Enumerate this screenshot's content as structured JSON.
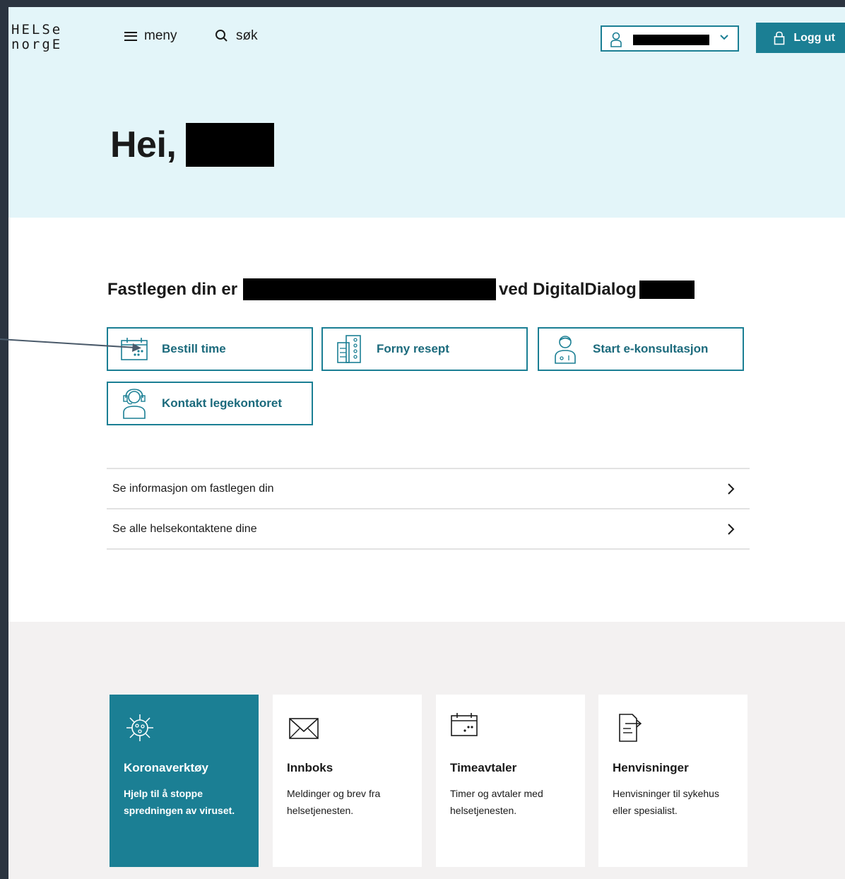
{
  "header": {
    "logo_top": "HELSe",
    "logo_bottom": "norgE",
    "menu_label": "meny",
    "search_label": "søk",
    "logout_label": "Logg ut"
  },
  "hero": {
    "greeting": "Hei,"
  },
  "gp": {
    "prefix": "Fastlegen din er",
    "middle": "ved DigitalDialog"
  },
  "actions": [
    {
      "label": "Bestill time",
      "icon": "calendar-icon"
    },
    {
      "label": "Forny resept",
      "icon": "pill-pack-icon"
    },
    {
      "label": "Start e-konsultasjon",
      "icon": "doctor-icon"
    },
    {
      "label": "Kontakt legekontoret",
      "icon": "headset-person-icon"
    }
  ],
  "links": [
    {
      "label": "Se informasjon om fastlegen din"
    },
    {
      "label": "Se alle helsekontaktene dine"
    }
  ],
  "tiles": [
    {
      "title": "Koronaverktøy",
      "desc": "Hjelp til å stoppe spredningen av viruset.",
      "icon": "virus-icon"
    },
    {
      "title": "Innboks",
      "desc": "Meldinger og brev fra helsetjenesten.",
      "icon": "envelope-icon"
    },
    {
      "title": "Timeavtaler",
      "desc": "Timer og avtaler med helsetjenesten.",
      "icon": "calendar-icon"
    },
    {
      "title": "Henvisninger",
      "desc": "Henvisninger til sykehus eller spesialist.",
      "icon": "document-arrow-icon"
    }
  ],
  "colors": {
    "accent": "#1b7f94",
    "hero_bg": "#e3f5f9",
    "bottom_bg": "#f3f1f1"
  }
}
